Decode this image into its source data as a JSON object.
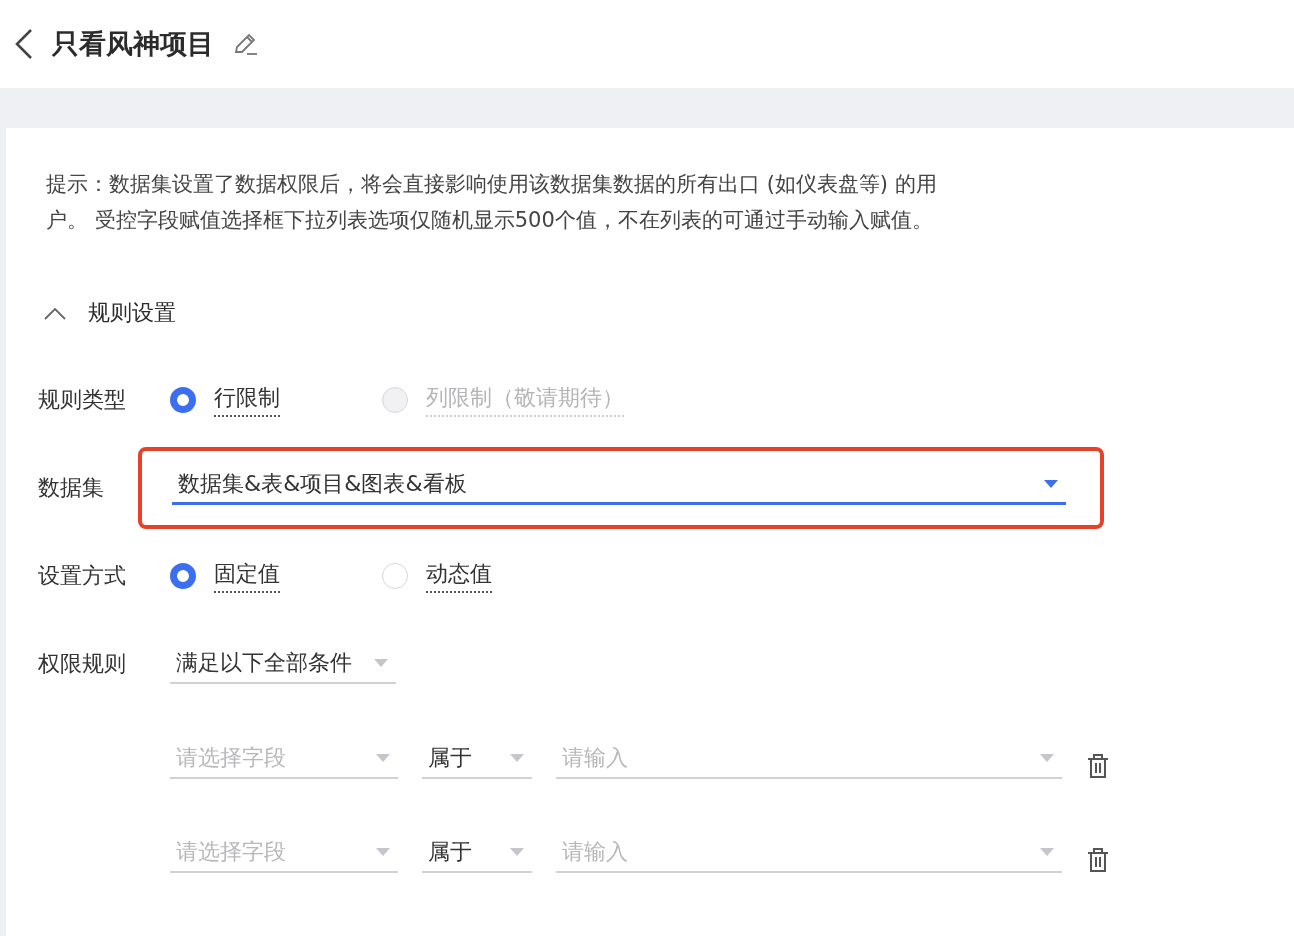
{
  "header": {
    "title": "只看风神项目"
  },
  "notice": "提示：数据集设置了数据权限后，将会直接影响使用该数据集数据的所有出口 (如仪表盘等) 的用户。 受控字段赋值选择框下拉列表选项仅随机显示500个值，不在列表的可通过手动输入赋值。",
  "section": {
    "title": "规则设置",
    "expanded": true
  },
  "rule_type": {
    "label": "规则类型",
    "options": [
      {
        "label": "行限制",
        "selected": true,
        "disabled": false
      },
      {
        "label": "列限制（敬请期待）",
        "selected": false,
        "disabled": true
      }
    ]
  },
  "dataset": {
    "label": "数据集",
    "value": "数据集&表&项目&图表&看板",
    "focused": true,
    "highlighted": true
  },
  "method": {
    "label": "设置方式",
    "options": [
      {
        "label": "固定值",
        "selected": true,
        "disabled": false
      },
      {
        "label": "动态值",
        "selected": false,
        "disabled": false
      }
    ]
  },
  "permission_rule": {
    "label": "权限规则",
    "value": "满足以下全部条件"
  },
  "conditions": [
    {
      "field_placeholder": "请选择字段",
      "operator": "属于",
      "value_placeholder": "请输入"
    },
    {
      "field_placeholder": "请选择字段",
      "operator": "属于",
      "value_placeholder": "请输入"
    }
  ]
}
